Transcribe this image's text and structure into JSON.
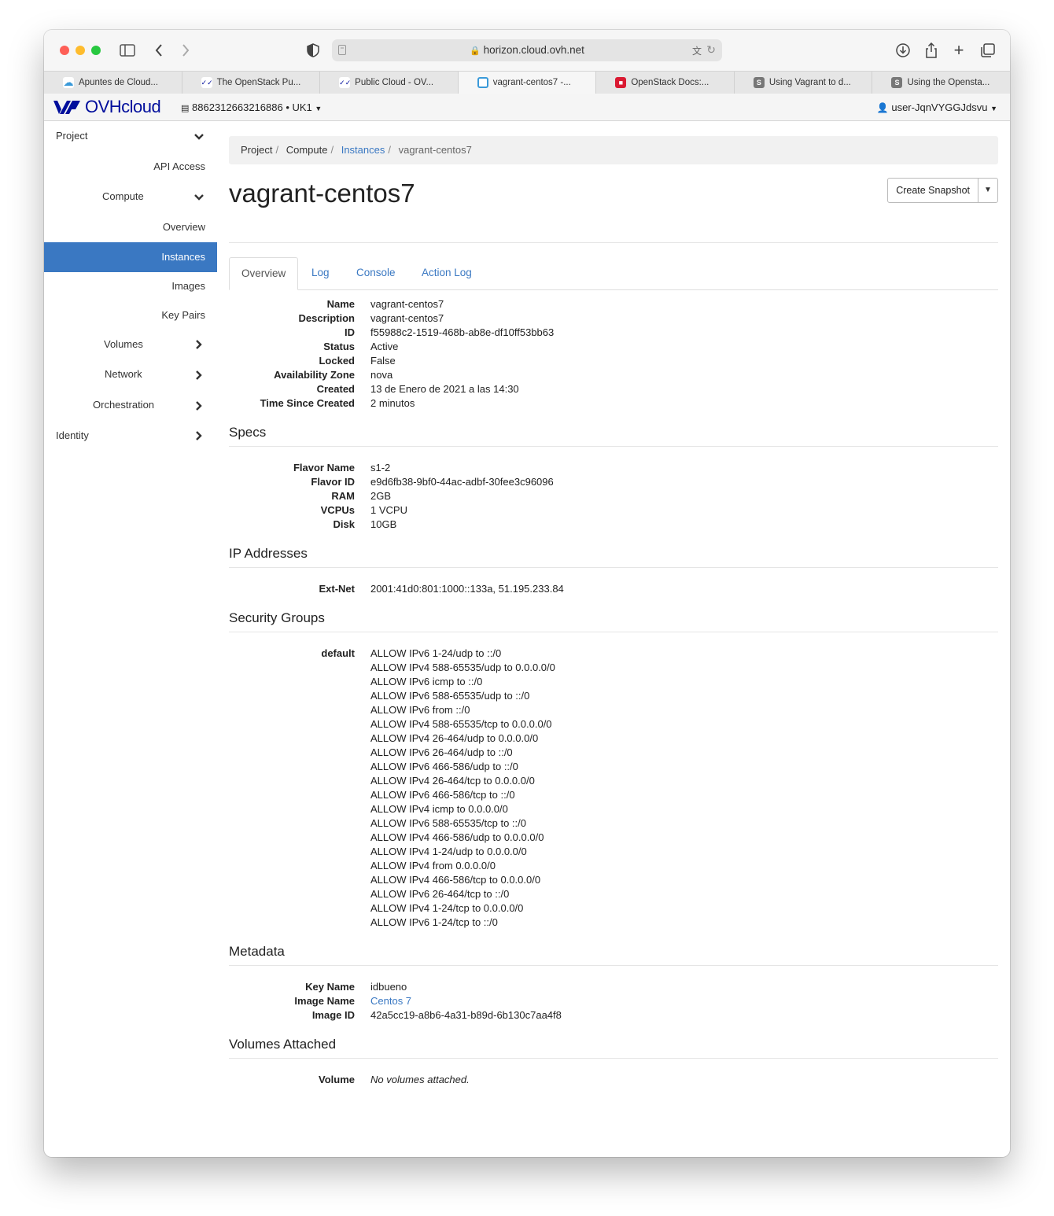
{
  "browser": {
    "url": "horizon.cloud.ovh.net",
    "tabs": [
      {
        "label": "Apuntes de Cloud...",
        "icon": "cloud-icon",
        "color": "#3a9ad9"
      },
      {
        "label": "The OpenStack Pu...",
        "icon": "ovh-icon",
        "color": "#000e9c"
      },
      {
        "label": "Public Cloud - OV...",
        "icon": "ovh-icon",
        "color": "#000e9c"
      },
      {
        "label": "vagrant-centos7 -...",
        "icon": "openstack-icon",
        "color": "#3a9ad9"
      },
      {
        "label": "OpenStack Docs:...",
        "icon": "openstack-red-icon",
        "color": "#da1a32"
      },
      {
        "label": "Using Vagrant to d...",
        "icon": "s-icon",
        "color": "#777777"
      },
      {
        "label": "Using the Opensta...",
        "icon": "s-icon",
        "color": "#777777"
      }
    ]
  },
  "header": {
    "brand": "OVHcloud",
    "project": "8862312663216886 • UK1",
    "user": "user-JqnVYGGJdsvu"
  },
  "sidebar": {
    "project": "Project",
    "api_access": "API Access",
    "compute": "Compute",
    "overview": "Overview",
    "instances": "Instances",
    "images": "Images",
    "key_pairs": "Key Pairs",
    "volumes": "Volumes",
    "network": "Network",
    "orchestration": "Orchestration",
    "identity": "Identity"
  },
  "breadcrumb": {
    "project": "Project",
    "compute": "Compute",
    "instances": "Instances",
    "current": "vagrant-centos7"
  },
  "page": {
    "title": "vagrant-centos7",
    "create_snapshot": "Create Snapshot"
  },
  "tabs": [
    "Overview",
    "Log",
    "Console",
    "Action Log"
  ],
  "overview": [
    {
      "label": "Name",
      "value": "vagrant-centos7"
    },
    {
      "label": "Description",
      "value": "vagrant-centos7"
    },
    {
      "label": "ID",
      "value": "f55988c2-1519-468b-ab8e-df10ff53bb63"
    },
    {
      "label": "Status",
      "value": "Active"
    },
    {
      "label": "Locked",
      "value": "False"
    },
    {
      "label": "Availability Zone",
      "value": "nova"
    },
    {
      "label": "Created",
      "value": "13 de Enero de 2021 a las 14:30"
    },
    {
      "label": "Time Since Created",
      "value": "2 minutos"
    }
  ],
  "specs": {
    "heading": "Specs",
    "rows": [
      {
        "label": "Flavor Name",
        "value": "s1-2"
      },
      {
        "label": "Flavor ID",
        "value": "e9d6fb38-9bf0-44ac-adbf-30fee3c96096"
      },
      {
        "label": "RAM",
        "value": "2GB"
      },
      {
        "label": "VCPUs",
        "value": "1 VCPU"
      },
      {
        "label": "Disk",
        "value": "10GB"
      }
    ]
  },
  "ip": {
    "heading": "IP Addresses",
    "rows": [
      {
        "label": "Ext-Net",
        "value": "2001:41d0:801:1000::133a,  51.195.233.84"
      }
    ]
  },
  "security": {
    "heading": "Security Groups",
    "group": "default",
    "rules": [
      "ALLOW IPv6 1-24/udp to ::/0",
      "ALLOW IPv4 588-65535/udp to 0.0.0.0/0",
      "ALLOW IPv6 icmp to ::/0",
      "ALLOW IPv6 588-65535/udp to ::/0",
      "ALLOW IPv6 from ::/0",
      "ALLOW IPv4 588-65535/tcp to 0.0.0.0/0",
      "ALLOW IPv4 26-464/udp to 0.0.0.0/0",
      "ALLOW IPv6 26-464/udp to ::/0",
      "ALLOW IPv6 466-586/udp to ::/0",
      "ALLOW IPv4 26-464/tcp to 0.0.0.0/0",
      "ALLOW IPv6 466-586/tcp to ::/0",
      "ALLOW IPv4 icmp to 0.0.0.0/0",
      "ALLOW IPv6 588-65535/tcp to ::/0",
      "ALLOW IPv4 466-586/udp to 0.0.0.0/0",
      "ALLOW IPv4 1-24/udp to 0.0.0.0/0",
      "ALLOW IPv4 from 0.0.0.0/0",
      "ALLOW IPv4 466-586/tcp to 0.0.0.0/0",
      "ALLOW IPv6 26-464/tcp to ::/0",
      "ALLOW IPv4 1-24/tcp to 0.0.0.0/0",
      "ALLOW IPv6 1-24/tcp to ::/0"
    ]
  },
  "metadata": {
    "heading": "Metadata",
    "rows": [
      {
        "label": "Key Name",
        "value": "idbueno"
      },
      {
        "label": "Image Name",
        "value": "Centos 7"
      },
      {
        "label": "Image ID",
        "value": "42a5cc19-a8b6-4a31-b89d-6b130c7aa4f8"
      }
    ]
  },
  "volumes": {
    "heading": "Volumes Attached",
    "label": "Volume",
    "value": "No volumes attached."
  },
  "colors": {
    "accent": "#3a78c2",
    "brand": "#000e9c"
  }
}
